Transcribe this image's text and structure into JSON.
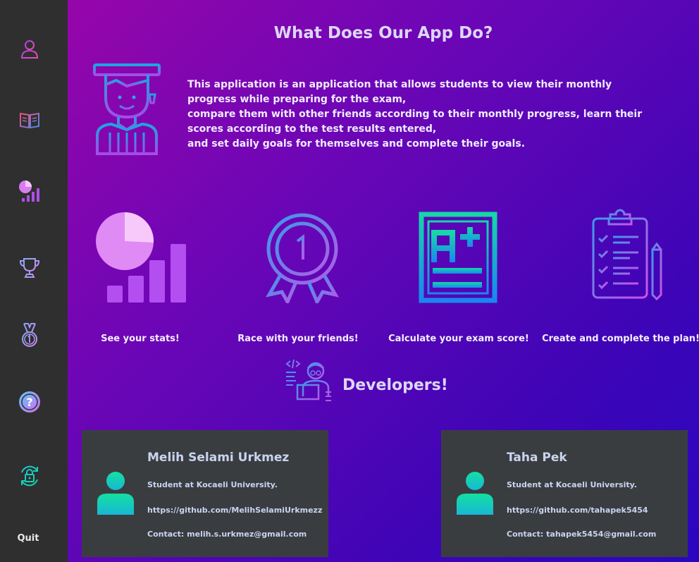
{
  "sidebar": {
    "items": [
      {
        "name": "profile-icon"
      },
      {
        "name": "book-icon"
      },
      {
        "name": "stats-icon"
      },
      {
        "name": "trophy-icon"
      },
      {
        "name": "medal-icon"
      },
      {
        "name": "help-icon"
      },
      {
        "name": "logout-lock-icon"
      }
    ],
    "quit_label": "Quit"
  },
  "main": {
    "title": "What Does Our App Do?",
    "intro": [
      "This application is an application that allows students to view their monthly progress while preparing for the exam,",
      "compare them with other friends according to their monthly progress, learn their scores according to the test results entered,",
      "and set daily goals for themselves and complete their goals."
    ],
    "features": [
      {
        "label": "See your stats!",
        "icon": "pie-bar-chart-icon"
      },
      {
        "label": "Race with your friends!",
        "icon": "medal-icon"
      },
      {
        "label": "Calculate your exam score!",
        "icon": "a-plus-grade-icon"
      },
      {
        "label": "Create and complete the plan!",
        "icon": "checklist-clipboard-icon"
      }
    ],
    "developers_heading": "Developers!"
  },
  "developers": [
    {
      "name": "Melih Selami Urkmez",
      "role": "Student at Kocaeli University.",
      "github": "https://github.com/MelihSelamiUrkmezz",
      "contact": "Contact: melih.s.urkmez@gmail.com"
    },
    {
      "name": "Taha Pek",
      "role": "Student at Kocaeli University.",
      "github": "https://github.com/tahapek5454",
      "contact": "Contact: tahapek5454@gmail.com"
    }
  ],
  "colors": {
    "sidebar": "#2f2f2f",
    "card": "#3a3d40",
    "accent_teal": "#12d6b0",
    "accent_purple": "#a24de8"
  }
}
